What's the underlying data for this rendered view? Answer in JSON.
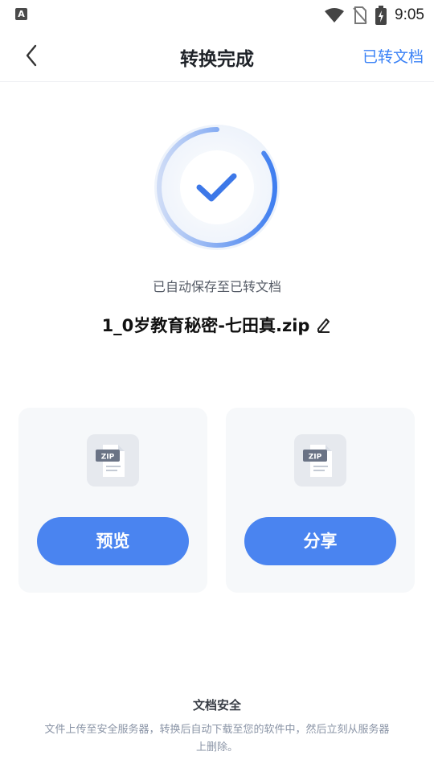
{
  "status_bar": {
    "time": "9:05",
    "app_icon_letter": "A"
  },
  "header": {
    "title": "转换完成",
    "right_link": "已转文档"
  },
  "result": {
    "status_text": "已自动保存至已转文档",
    "filename": "1_0岁教育秘密-七田真.zip",
    "ring_progress": 0.85
  },
  "cards": [
    {
      "badge": "ZIP",
      "button_label": "预览"
    },
    {
      "badge": "ZIP",
      "button_label": "分享"
    }
  ],
  "footer": {
    "title": "文档安全",
    "description": "文件上传至安全服务器，转换后自动下载至您的软件中，然后立刻从服务器上删除。"
  },
  "colors": {
    "accent": "#4a84f0",
    "link": "#3b82f6"
  }
}
